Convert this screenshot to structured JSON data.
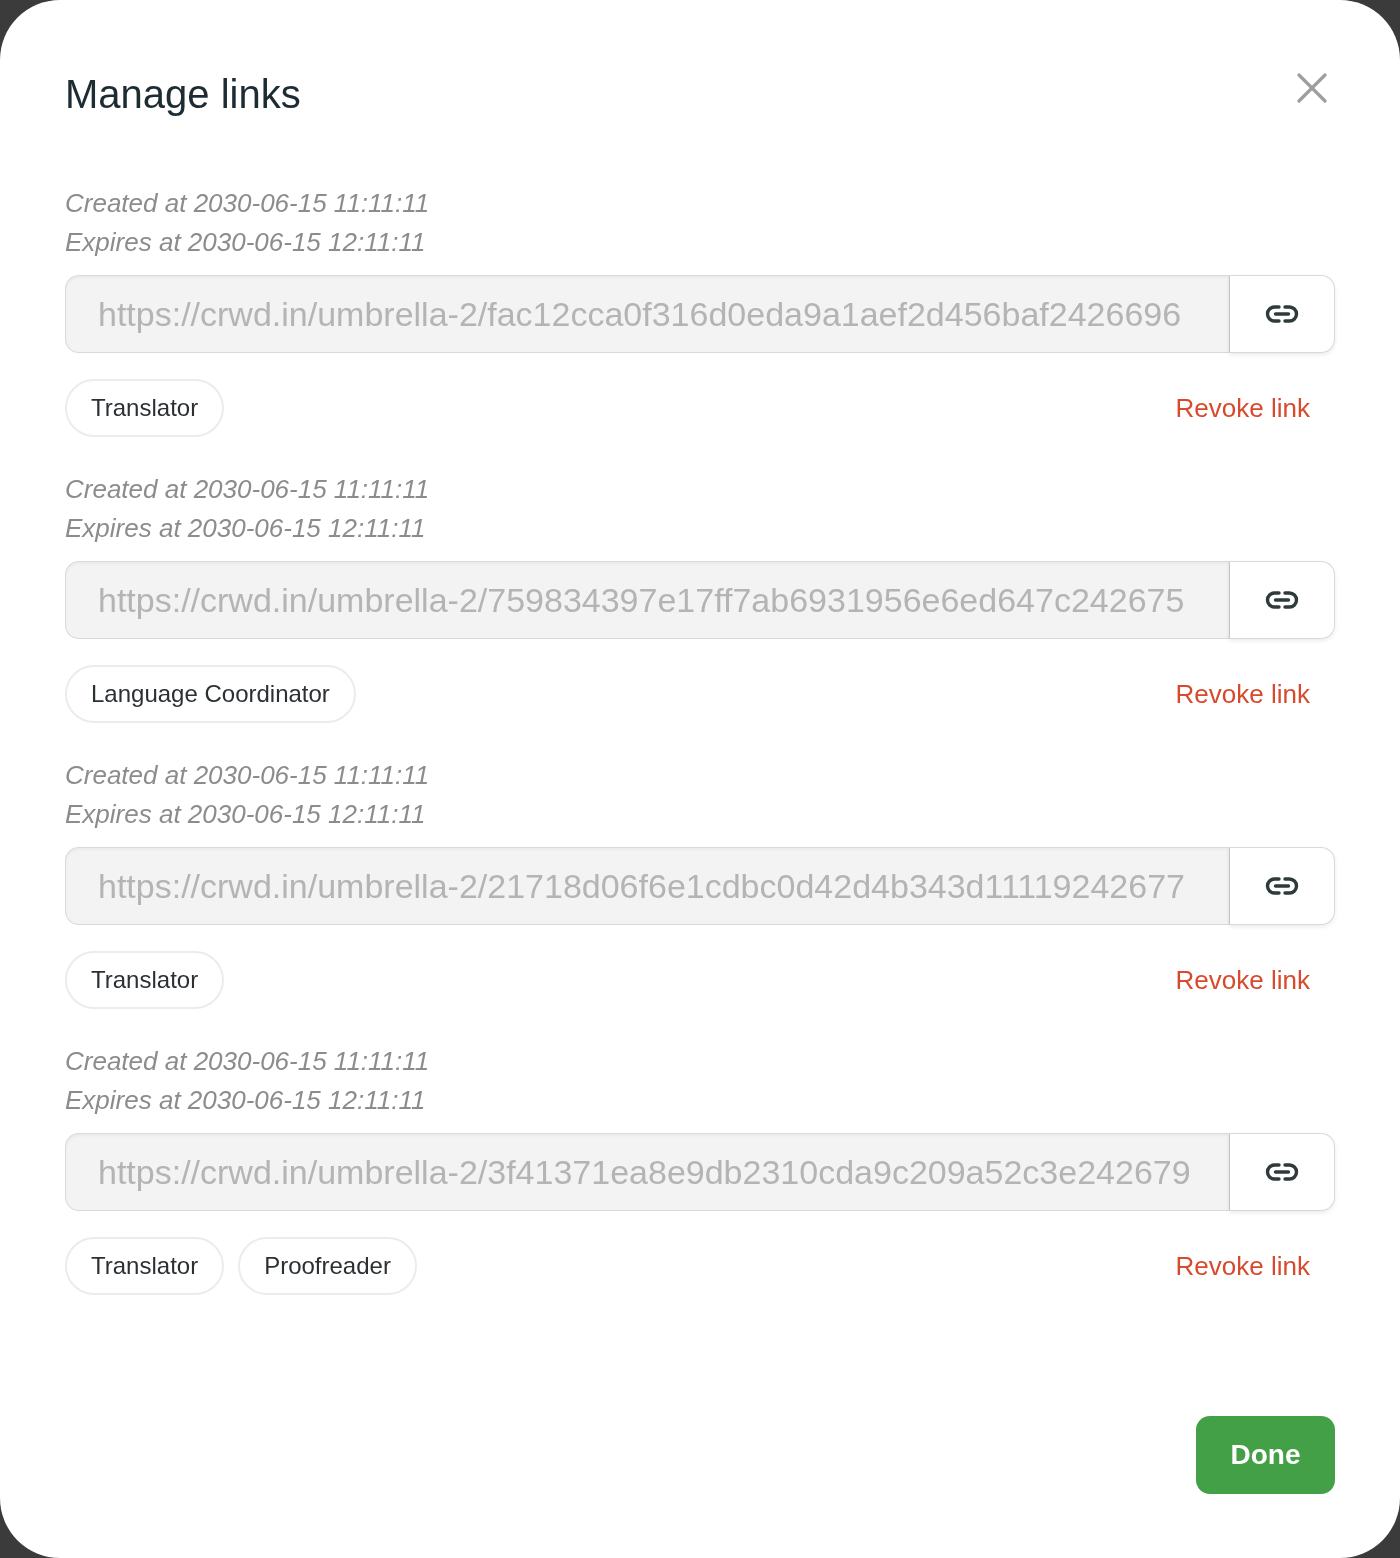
{
  "dialog": {
    "title": "Manage links"
  },
  "links": [
    {
      "created": "Created at 2030-06-15 11:11:11",
      "expires": "Expires at 2030-06-15 12:11:11",
      "field": {
        "value": "https://crwd.in/umbrella-2/fac12cca0f316d0eda9a1aef2d456baf2426696",
        "disabled": true
      },
      "roles": [
        "Translator"
      ],
      "revoke": "Revoke link"
    },
    {
      "created": "Created at 2030-06-15 11:11:11",
      "expires": "Expires at 2030-06-15 12:11:11",
      "field": {
        "value": "https://crwd.in/umbrella-2/759834397e17ff7ab6931956e6ed647c242675",
        "disabled": true
      },
      "roles": [
        "Language Coordinator"
      ],
      "revoke": "Revoke link"
    },
    {
      "created": "Created at 2030-06-15 11:11:11",
      "expires": "Expires at 2030-06-15 12:11:11",
      "field": {
        "value": "https://crwd.in/umbrella-2/21718d06f6e1cdbc0d42d4b343d11119242677",
        "disabled": true
      },
      "roles": [
        "Translator"
      ],
      "revoke": "Revoke link"
    },
    {
      "created": "Created at 2030-06-15 11:11:11",
      "expires": "Expires at 2030-06-15 12:11:11",
      "field": {
        "value": "https://crwd.in/umbrella-2/3f41371ea8e9db2310cda9c209a52c3e242679",
        "disabled": true
      },
      "roles": [
        "Translator",
        "Proofreader"
      ],
      "revoke": "Revoke link"
    }
  ],
  "footer": {
    "done_button": "Done"
  }
}
